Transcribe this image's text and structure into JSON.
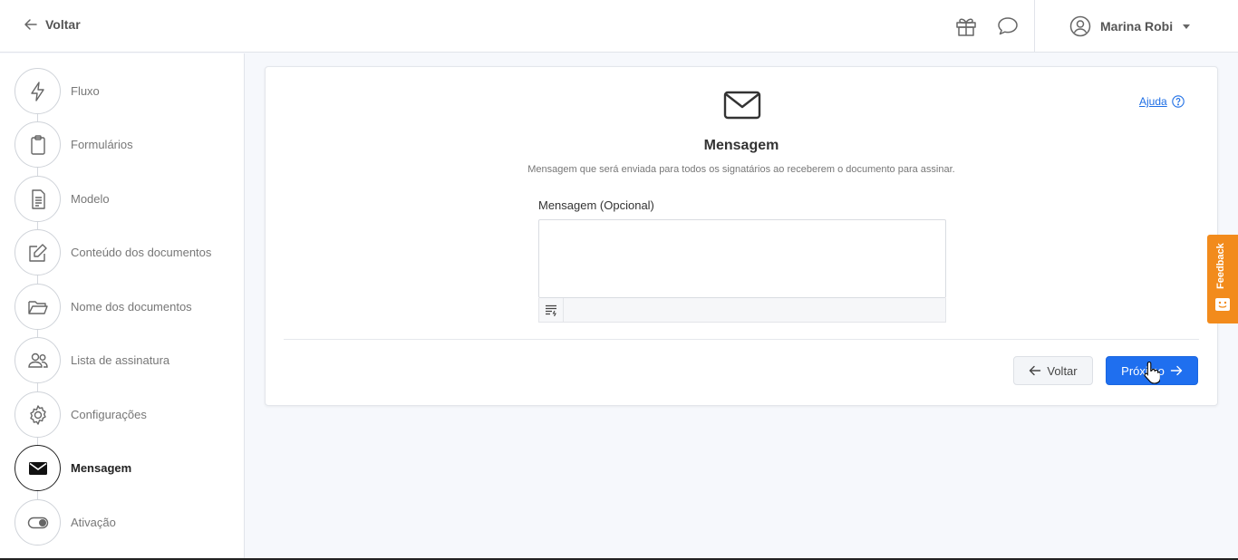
{
  "topbar": {
    "back_label": "Voltar",
    "user_name": "Marina Robi"
  },
  "sidebar": {
    "steps": [
      {
        "label": "Fluxo",
        "icon": "lightning-icon"
      },
      {
        "label": "Formulários",
        "icon": "clipboard-icon"
      },
      {
        "label": "Modelo",
        "icon": "document-icon"
      },
      {
        "label": "Conteúdo dos documentos",
        "icon": "edit-icon"
      },
      {
        "label": "Nome dos documentos",
        "icon": "folder-icon"
      },
      {
        "label": "Lista de assinatura",
        "icon": "users-icon"
      },
      {
        "label": "Configurações",
        "icon": "gear-icon"
      },
      {
        "label": "Mensagem",
        "icon": "envelope-icon",
        "active": true
      },
      {
        "label": "Ativação",
        "icon": "toggle-icon"
      }
    ]
  },
  "main": {
    "help_label": "Ajuda",
    "title": "Mensagem",
    "subtitle": "Mensagem que será enviada para todos os signatários ao receberem o documento para assinar.",
    "field_label": "Mensagem (Opcional)",
    "field_value": "",
    "back_button": "Voltar",
    "next_button": "Próximo"
  },
  "feedback": {
    "label": "Feedback"
  },
  "colors": {
    "primary": "#1f6fef",
    "feedback": "#f28b1c"
  }
}
